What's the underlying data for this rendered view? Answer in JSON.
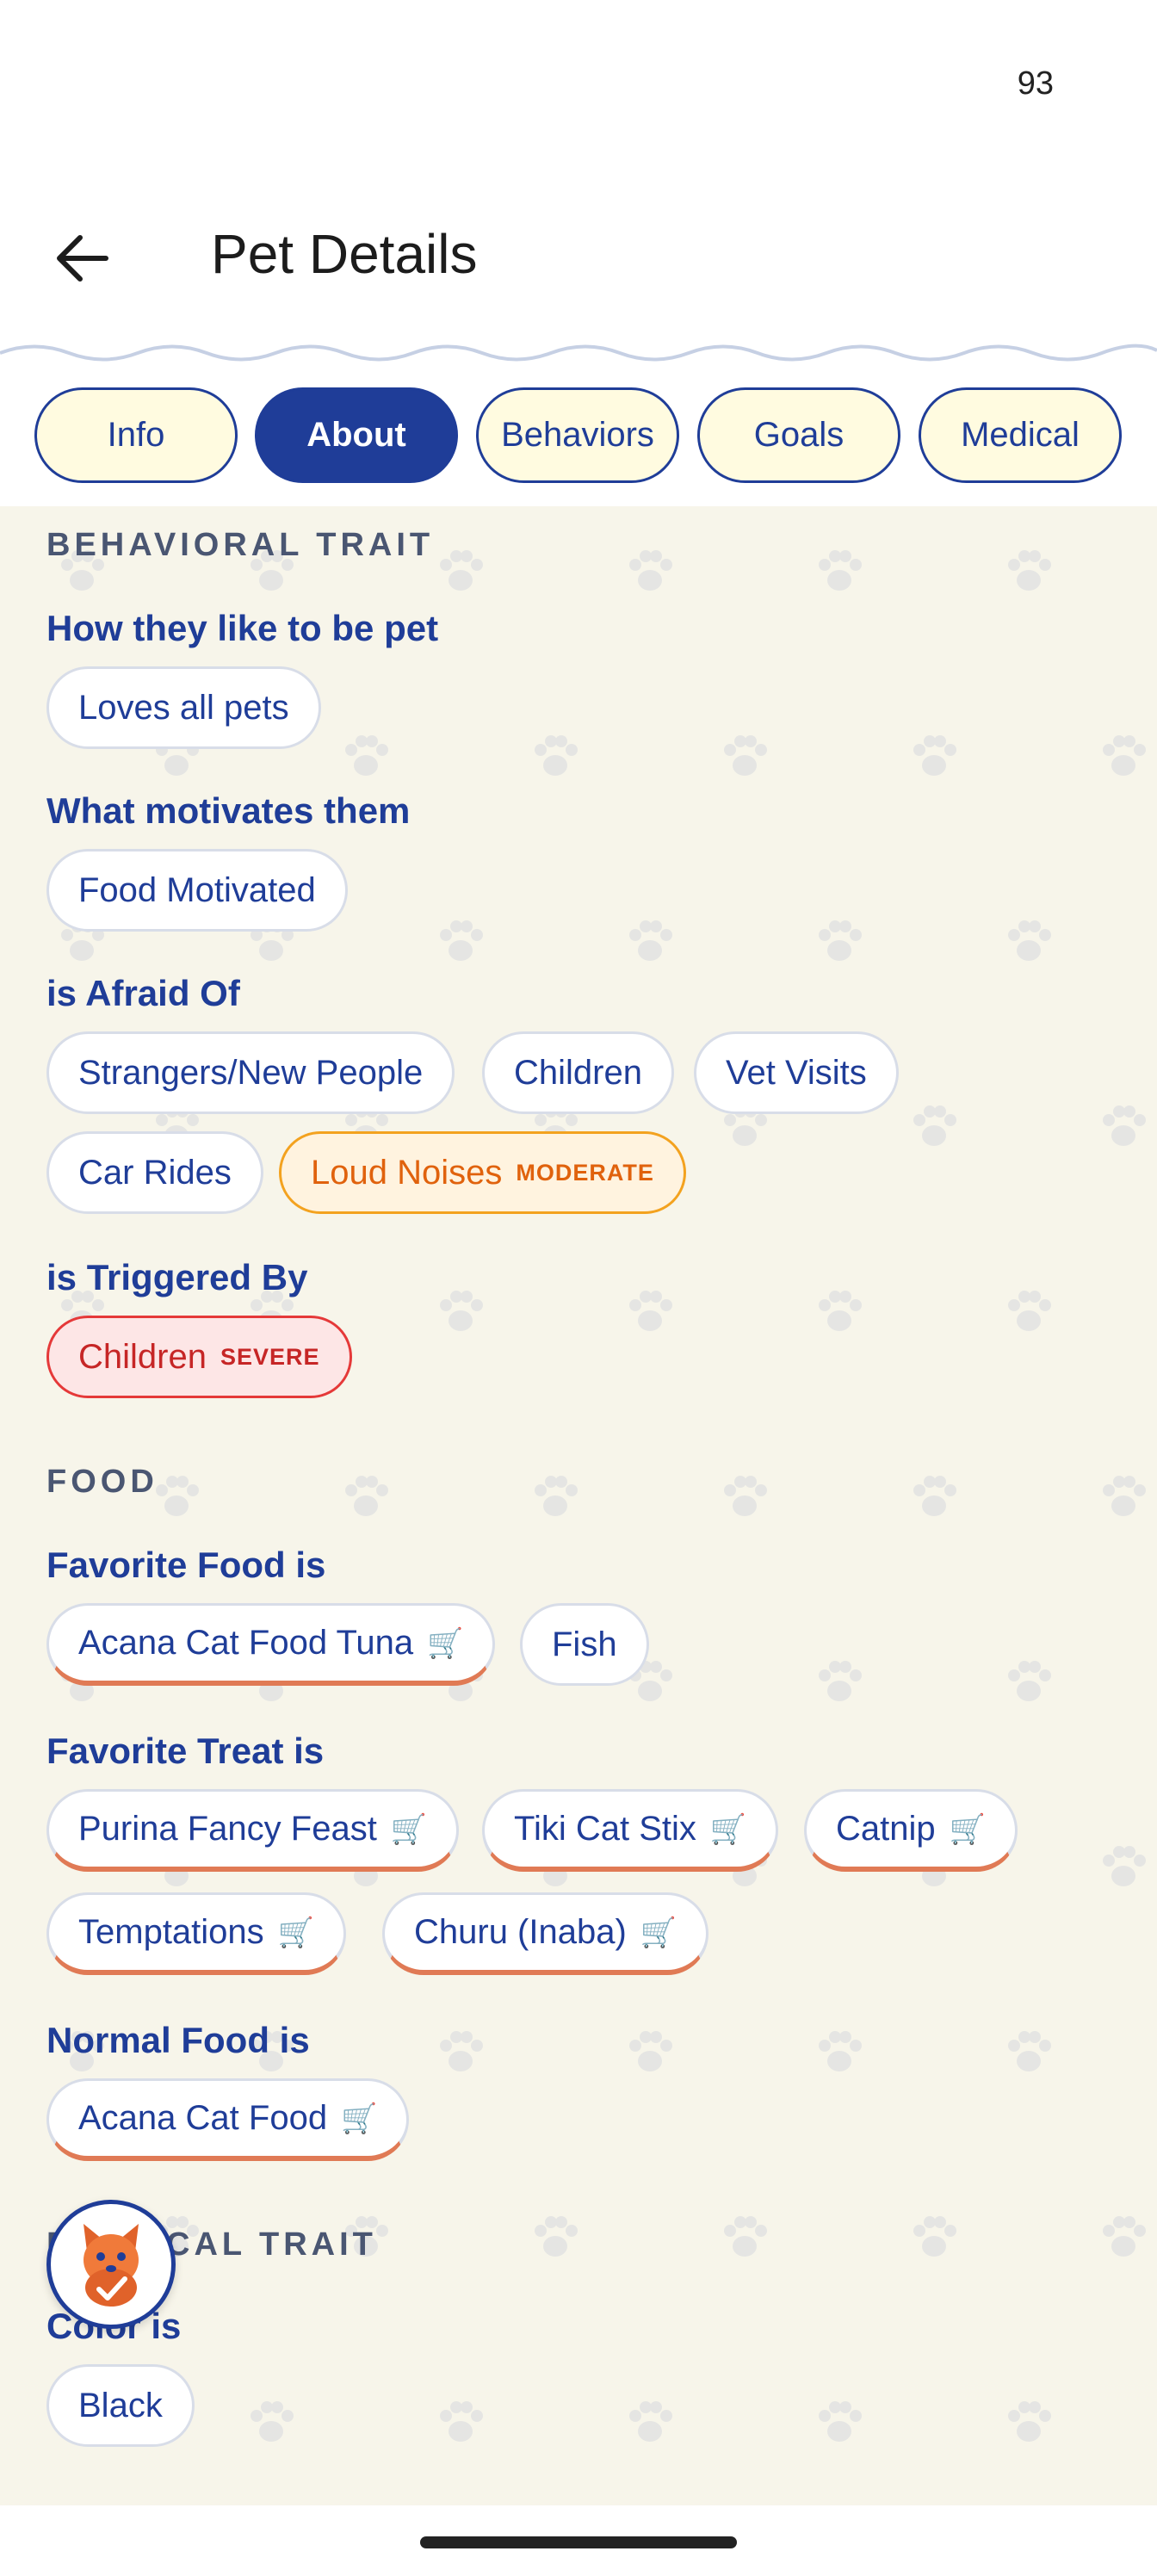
{
  "status_bar": {
    "time": "93"
  },
  "header": {
    "title": "Pet Details",
    "back_icon": "arrow-left-icon"
  },
  "tabs": [
    {
      "label": "Info",
      "active": false
    },
    {
      "label": "About",
      "active": true
    },
    {
      "label": "Behaviors",
      "active": false
    },
    {
      "label": "Goals",
      "active": false
    },
    {
      "label": "Medical",
      "active": false
    }
  ],
  "behavioral": {
    "header": "BEHAVIORAL TRAIT",
    "pet_label": "How they like to be pet",
    "pet_chips": [
      "Loves all pets"
    ],
    "motivates_label": "What motivates them",
    "motivates_chips": [
      "Food Motivated"
    ],
    "afraid_label": "is Afraid Of",
    "afraid_chips": [
      "Strangers/New People",
      "Children",
      "Vet Visits",
      "Car Rides"
    ],
    "afraid_severity_chip": {
      "label": "Loud Noises",
      "severity": "MODERATE"
    },
    "triggered_label": "is Triggered By",
    "triggered_chip": {
      "label": "Children",
      "severity": "SEVERE"
    }
  },
  "food": {
    "header": "FOOD",
    "favorite_food_label": "Favorite Food is",
    "favorite_food_chips": [
      {
        "label": "Acana Cat Food Tuna",
        "shop": true
      },
      {
        "label": "Fish",
        "shop": false
      }
    ],
    "favorite_treat_label": "Favorite Treat is",
    "favorite_treat_chips": [
      {
        "label": "Purina Fancy Feast",
        "shop": true
      },
      {
        "label": "Tiki Cat Stix",
        "shop": true
      },
      {
        "label": "Catnip",
        "shop": true
      },
      {
        "label": "Temptations",
        "shop": true
      },
      {
        "label": "Churu (Inaba)",
        "shop": true
      }
    ],
    "normal_food_label": "Normal Food is",
    "normal_food_chips": [
      {
        "label": "Acana Cat Food",
        "shop": true
      }
    ]
  },
  "physical": {
    "header": "PHYSICAL TRAIT",
    "color_label": "Color is",
    "color_chips": [
      "Black"
    ]
  },
  "icons": {
    "cart": "🛒",
    "fab": "pet-assistant-icon"
  },
  "colors": {
    "primary": "#1f3d98",
    "tab_bg": "#fffbe0",
    "content_bg": "#f7f5ea",
    "shop_underline": "#e07a55",
    "moderate": "#e0620d",
    "severe": "#c62626"
  }
}
